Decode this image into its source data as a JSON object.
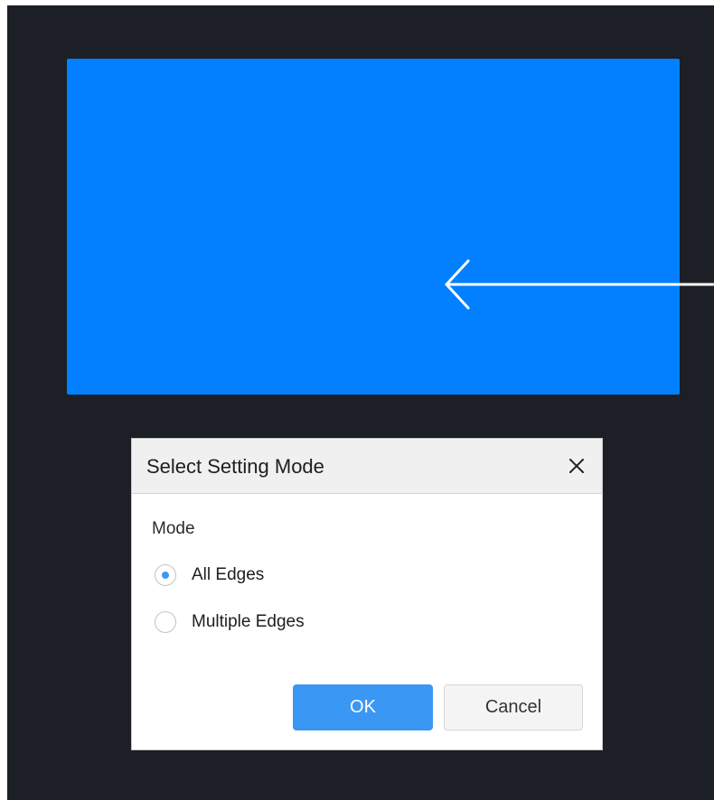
{
  "dialog": {
    "title": "Select Setting Mode",
    "mode_label": "Mode",
    "options": [
      {
        "label": "All Edges",
        "checked": true
      },
      {
        "label": "Multiple Edges",
        "checked": false
      }
    ],
    "ok_label": "OK",
    "cancel_label": "Cancel"
  },
  "preview": {
    "direction_icon": "arrow-left-icon",
    "background_color": "#0280ff"
  },
  "colors": {
    "workspace": "#1c1f25",
    "accent": "#3a97f4",
    "radio_selected": "#3f97f4"
  }
}
